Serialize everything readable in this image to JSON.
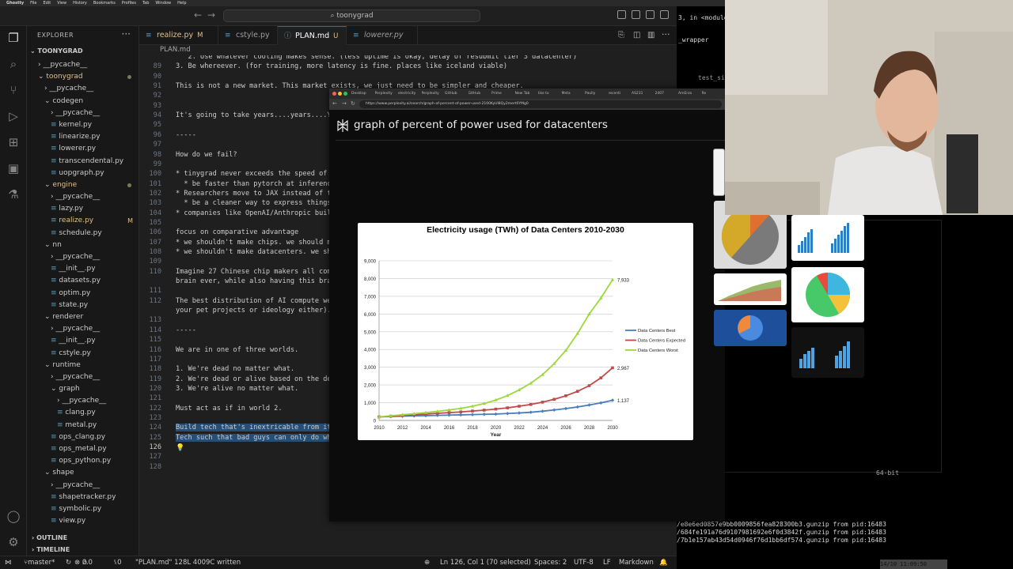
{
  "menubar": [
    "Ghostty",
    "File",
    "Edit",
    "View",
    "History",
    "Bookmarks",
    "Profiles",
    "Tab",
    "Window",
    "Help"
  ],
  "titlebar": {
    "search": "toonygrad"
  },
  "sidebar": {
    "header": "EXPLORER",
    "root": "TOONYGRAD",
    "tree": [
      {
        "label": "__pycache__",
        "depth": 1,
        "kind": "folder-closed"
      },
      {
        "label": "toonygrad",
        "depth": 1,
        "kind": "folder-open",
        "mod": true,
        "dot": true
      },
      {
        "label": "__pycache__",
        "depth": 2,
        "kind": "folder-closed"
      },
      {
        "label": "codegen",
        "depth": 2,
        "kind": "folder-open"
      },
      {
        "label": "__pycache__",
        "depth": 3,
        "kind": "folder-closed"
      },
      {
        "label": "kernel.py",
        "depth": 3,
        "kind": "file"
      },
      {
        "label": "linearize.py",
        "depth": 3,
        "kind": "file"
      },
      {
        "label": "lowerer.py",
        "depth": 3,
        "kind": "file"
      },
      {
        "label": "transcendental.py",
        "depth": 3,
        "kind": "file"
      },
      {
        "label": "uopgraph.py",
        "depth": 3,
        "kind": "file"
      },
      {
        "label": "engine",
        "depth": 2,
        "kind": "folder-open",
        "mod": true,
        "dot": true
      },
      {
        "label": "__pycache__",
        "depth": 3,
        "kind": "folder-closed"
      },
      {
        "label": "lazy.py",
        "depth": 3,
        "kind": "file"
      },
      {
        "label": "realize.py",
        "depth": 3,
        "kind": "file",
        "mod": true,
        "badge": "M"
      },
      {
        "label": "schedule.py",
        "depth": 3,
        "kind": "file"
      },
      {
        "label": "nn",
        "depth": 2,
        "kind": "folder-open"
      },
      {
        "label": "__pycache__",
        "depth": 3,
        "kind": "folder-closed"
      },
      {
        "label": "__init__.py",
        "depth": 3,
        "kind": "file"
      },
      {
        "label": "datasets.py",
        "depth": 3,
        "kind": "file"
      },
      {
        "label": "optim.py",
        "depth": 3,
        "kind": "file"
      },
      {
        "label": "state.py",
        "depth": 3,
        "kind": "file"
      },
      {
        "label": "renderer",
        "depth": 2,
        "kind": "folder-open"
      },
      {
        "label": "__pycache__",
        "depth": 3,
        "kind": "folder-closed"
      },
      {
        "label": "__init__.py",
        "depth": 3,
        "kind": "file"
      },
      {
        "label": "cstyle.py",
        "depth": 3,
        "kind": "file"
      },
      {
        "label": "runtime",
        "depth": 2,
        "kind": "folder-open"
      },
      {
        "label": "__pycache__",
        "depth": 3,
        "kind": "folder-closed"
      },
      {
        "label": "graph",
        "depth": 3,
        "kind": "folder-open"
      },
      {
        "label": "__pycache__",
        "depth": 4,
        "kind": "folder-closed"
      },
      {
        "label": "clang.py",
        "depth": 4,
        "kind": "file"
      },
      {
        "label": "metal.py",
        "depth": 4,
        "kind": "file"
      },
      {
        "label": "ops_clang.py",
        "depth": 3,
        "kind": "file"
      },
      {
        "label": "ops_metal.py",
        "depth": 3,
        "kind": "file"
      },
      {
        "label": "ops_python.py",
        "depth": 3,
        "kind": "file"
      },
      {
        "label": "shape",
        "depth": 2,
        "kind": "folder-open"
      },
      {
        "label": "__pycache__",
        "depth": 3,
        "kind": "folder-closed"
      },
      {
        "label": "shapetracker.py",
        "depth": 3,
        "kind": "file"
      },
      {
        "label": "symbolic.py",
        "depth": 3,
        "kind": "file"
      },
      {
        "label": "view.py",
        "depth": 3,
        "kind": "file"
      }
    ],
    "outline": "OUTLINE",
    "timeline": "TIMELINE"
  },
  "tabs": [
    {
      "label": "realize.py",
      "suffix": "M",
      "active": false,
      "italic": false
    },
    {
      "label": "cstyle.py",
      "suffix": "",
      "active": false,
      "italic": false
    },
    {
      "label": "PLAN.md",
      "suffix": "U",
      "active": true,
      "italic": false
    },
    {
      "label": "lowerer.py",
      "suffix": "",
      "active": false,
      "italic": true
    }
  ],
  "breadcrumb": "PLAN.md",
  "editor": {
    "lines": [
      {
        "n": "",
        "text": "   2. Use whatever cooling makes sense. (less uptime is okay, delay of resubmit tier 3 datacenter)"
      },
      {
        "n": "89",
        "text": "3. Be whereever. (for training, more latency is fine. places like iceland viable)"
      },
      {
        "n": "90",
        "text": ""
      },
      {
        "n": "91",
        "text": "This is not a new market. This market exists, we just need to be simpler and cheaper."
      },
      {
        "n": "92",
        "text": ""
      },
      {
        "n": "93",
        "text": ""
      },
      {
        "n": "94",
        "text": "It's going to take years....years....YE"
      },
      {
        "n": "95",
        "text": ""
      },
      {
        "n": "96",
        "text": "-----"
      },
      {
        "n": "97",
        "text": ""
      },
      {
        "n": "98",
        "text": "How do we fail?"
      },
      {
        "n": "99",
        "text": ""
      },
      {
        "n": "100",
        "text": "* tinygrad never exceeds the speed of P"
      },
      {
        "n": "101",
        "text": "  * be faster than pytorch at inferenc"
      },
      {
        "n": "102",
        "text": "* Researchers move to JAX instead of ti"
      },
      {
        "n": "103",
        "text": "  * be a cleaner way to express things"
      },
      {
        "n": "104",
        "text": "* companies like OpenAI/Anthropic build"
      },
      {
        "n": "105",
        "text": ""
      },
      {
        "n": "106",
        "text": "focus on comparative advantage"
      },
      {
        "n": "107",
        "text": "* we shouldn't make chips. we should ma"
      },
      {
        "n": "108",
        "text": "* we shouldn't make datacenters. we sho"
      },
      {
        "n": "109",
        "text": ""
      },
      {
        "n": "110",
        "text": "Imagine 27 Chinese chip makers all comp"
      },
      {
        "n": "",
        "text": "brain ever, while also having this brai"
      },
      {
        "n": "111",
        "text": ""
      },
      {
        "n": "112",
        "text": "The best distribution of AI compute we"
      },
      {
        "n": "",
        "text": "your pet projects or ideology either)."
      },
      {
        "n": "113",
        "text": ""
      },
      {
        "n": "114",
        "text": "-----"
      },
      {
        "n": "115",
        "text": ""
      },
      {
        "n": "116",
        "text": "We are in one of three worlds."
      },
      {
        "n": "117",
        "text": ""
      },
      {
        "n": "118",
        "text": "1. We're dead no matter what."
      },
      {
        "n": "119",
        "text": "2. We're dead or alive based on the dec"
      },
      {
        "n": "120",
        "text": "3. We're alive no matter what."
      },
      {
        "n": "121",
        "text": ""
      },
      {
        "n": "122",
        "text": "Must act as if in world 2."
      },
      {
        "n": "123",
        "text": ""
      },
      {
        "n": "124",
        "text": "Build tech that's inextricable from its"
      },
      {
        "n": "125",
        "text": "Tech such that bad guys can only do wha"
      },
      {
        "n": "126",
        "text": ""
      },
      {
        "n": "127",
        "text": ""
      },
      {
        "n": "128",
        "text": ""
      }
    ]
  },
  "statusbar": {
    "branch": "master*",
    "errors": "0",
    "warnings": "0",
    "ports": "0",
    "message": "\"PLAN.md\" 128L 4009C written",
    "position": "Ln 126, Col 1 (70 selected)",
    "spaces": "Spaces: 2",
    "encoding": "UTF-8",
    "eol": "LF",
    "language": "Markdown"
  },
  "browser": {
    "tabs": [
      "Desktop",
      "Perplexity",
      "electricity",
      "Perplexity",
      "GitHub",
      "GitHub",
      "Prime",
      "New Tab",
      "like to",
      "Meta",
      "Paully",
      "recenti",
      "AS231",
      "2407",
      "AmErzo",
      "Re"
    ],
    "url": "https://www.perplexity.ai/search/graph-of-percent-of-power-used-2100KyUl8Qy2mert0YMg0",
    "query": "graph of percent of power used for datacenters"
  },
  "chart_data": {
    "type": "line",
    "title": "Electricity usage (TWh) of Data Centers 2010-2030",
    "xlabel": "Year",
    "ylabel": "",
    "x": [
      2010,
      2011,
      2012,
      2013,
      2014,
      2015,
      2016,
      2017,
      2018,
      2019,
      2020,
      2021,
      2022,
      2023,
      2024,
      2025,
      2026,
      2027,
      2028,
      2029,
      2030
    ],
    "xticks": [
      "2010",
      "2012",
      "2014",
      "2016",
      "2018",
      "2020",
      "2022",
      "2024",
      "2026",
      "2028",
      "2030"
    ],
    "ylim": [
      0,
      9000
    ],
    "yticks": [
      "0",
      "1,000",
      "2,000",
      "3,000",
      "4,000",
      "5,000",
      "6,000",
      "7,000",
      "8,000",
      "9,000"
    ],
    "grid": true,
    "legend_position": "right",
    "series": [
      {
        "name": "Data Centers Best",
        "color": "#4a7ebb",
        "values": [
          200,
          220,
          240,
          255,
          270,
          285,
          300,
          315,
          330,
          345,
          360,
          390,
          420,
          460,
          520,
          590,
          670,
          760,
          870,
          990,
          1137
        ],
        "end_label": "1,137"
      },
      {
        "name": "Data Centers Expected",
        "color": "#be4b48",
        "values": [
          200,
          240,
          280,
          320,
          360,
          400,
          440,
          480,
          530,
          580,
          640,
          710,
          800,
          900,
          1030,
          1190,
          1390,
          1640,
          1960,
          2400,
          2967
        ],
        "end_label": "2,967"
      },
      {
        "name": "Data Centers Worst",
        "color": "#9bd83a",
        "values": [
          200,
          260,
          320,
          380,
          440,
          510,
          590,
          680,
          800,
          950,
          1150,
          1400,
          1720,
          2100,
          2580,
          3200,
          3950,
          4900,
          6000,
          6900,
          7933
        ],
        "end_label": "7,933"
      }
    ]
  },
  "terminal": {
    "lines_top": [
      "3, in <module",
      "_wrapper",
      "test_simpli"
    ],
    "lines_bottom": [
      "/e8e6ed0857e9bb0009856fea828300b3.gunzip from pid:16483",
      "/684fe191a76d9107981692e6f0d3842f.gunzip from pid:16483",
      "/7b1e157ab43d54d0946f76d1bb6df574.gunzip from pid:16483"
    ],
    "side_label": "64-bit",
    "status": "14/10   11:09:50"
  }
}
